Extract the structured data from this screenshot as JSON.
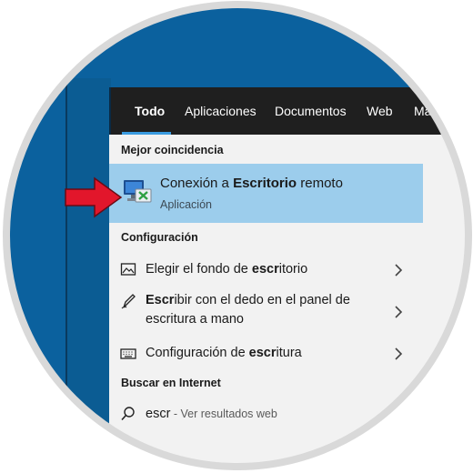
{
  "tabs": [
    {
      "label": "Todo",
      "active": true
    },
    {
      "label": "Aplicaciones"
    },
    {
      "label": "Documentos"
    },
    {
      "label": "Web"
    },
    {
      "label": "Más"
    }
  ],
  "best_match": {
    "heading": "Mejor coincidencia",
    "title_pre": "Conexión a ",
    "title_bold": "Escritorio",
    "title_post": " remoto",
    "subtitle": "Aplicación",
    "icon": "remote-desktop-icon"
  },
  "settings": {
    "heading": "Configuración",
    "items": [
      {
        "icon": "image-icon",
        "pre": "Elegir el fondo de ",
        "bold": "escr",
        "post": "itorio"
      },
      {
        "icon": "pen-icon",
        "pre": "",
        "bold": "Escr",
        "post": "ibir con el dedo en el panel de",
        "line2": "escritura a mano"
      },
      {
        "icon": "keyboard-icon",
        "pre": "Configuración de ",
        "bold": "escr",
        "post": "itura"
      }
    ]
  },
  "web": {
    "heading": "Buscar en Internet",
    "query": "escr",
    "suffix": " - Ver resultados web",
    "icon": "search-icon"
  },
  "colors": {
    "selected": "#9ccdec",
    "topbar": "#1f1f1f",
    "accent": "#3a9be0",
    "arrow": "#e2162b",
    "desktop": "#0b619e"
  }
}
